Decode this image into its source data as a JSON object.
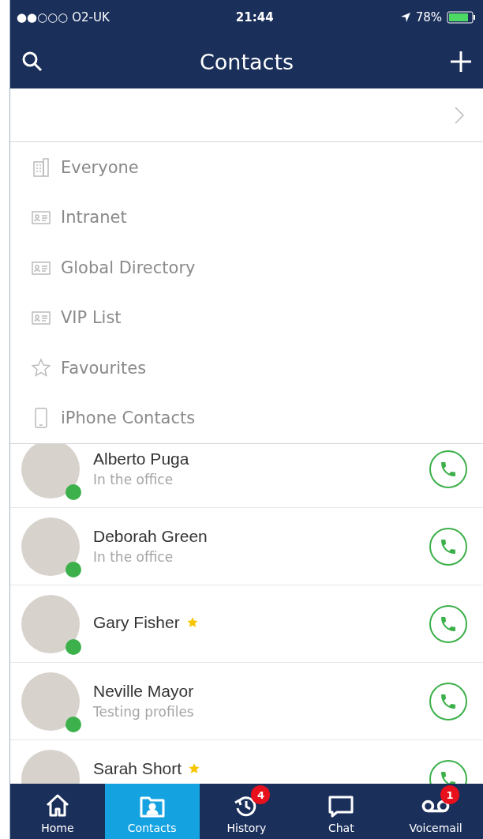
{
  "status_bar": {
    "carrier": "●●○○○ O2-UK",
    "time": "21:44",
    "battery": "78%"
  },
  "nav_bar": {
    "title": "Contacts"
  },
  "menu": [
    {
      "kind": "building",
      "label": "Everyone"
    },
    {
      "kind": "card",
      "label": "Intranet"
    },
    {
      "kind": "card",
      "label": "Global Directory"
    },
    {
      "kind": "card",
      "label": "VIP List"
    },
    {
      "kind": "star",
      "label": "Favourites"
    },
    {
      "kind": "phone",
      "label": "iPhone Contacts"
    }
  ],
  "contacts": [
    {
      "name": "Alberto Puga",
      "status": "In the office",
      "online": true,
      "favourite": false
    },
    {
      "name": "Deborah Green",
      "status": "In the office",
      "online": true,
      "favourite": false
    },
    {
      "name": "Gary Fisher",
      "online": true,
      "favourite": true
    },
    {
      "name": "Neville Mayor",
      "status": "Testing profiles",
      "online": true,
      "favourite": false
    },
    {
      "name": "Sarah Short",
      "favourite": true
    }
  ],
  "tabs": [
    {
      "kind": "home",
      "label": "Home",
      "selected": false
    },
    {
      "kind": "contacts",
      "label": "Contacts",
      "selected": true
    },
    {
      "kind": "history",
      "label": "History",
      "selected": false,
      "badge": "4"
    },
    {
      "kind": "chat",
      "label": "Chat",
      "selected": false
    },
    {
      "kind": "voicemail",
      "label": "Voicemail",
      "selected": false,
      "badge": "1"
    }
  ]
}
